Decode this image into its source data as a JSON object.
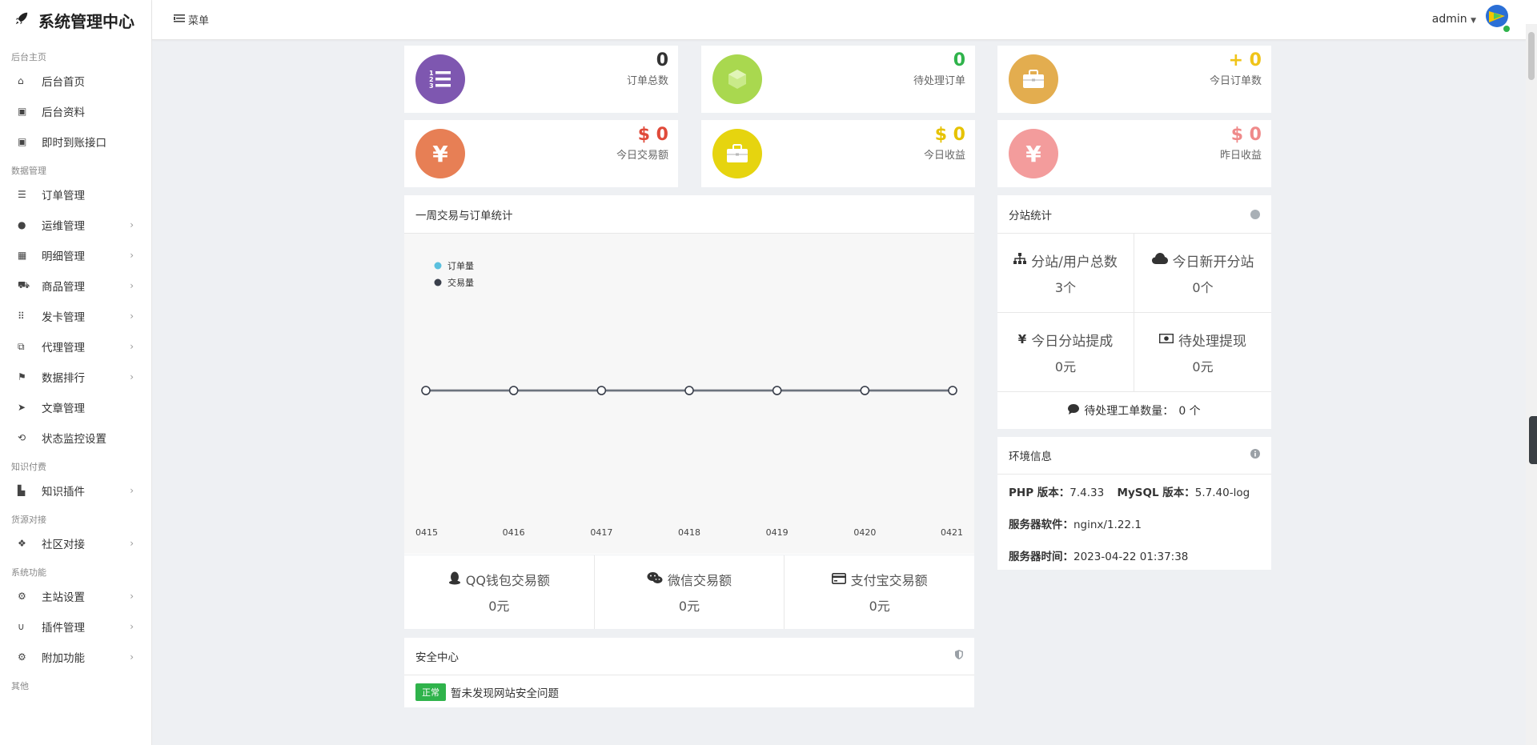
{
  "brand": {
    "title": "系统管理中心",
    "icon": "rocket-icon"
  },
  "topbar": {
    "menu_label": "菜单",
    "user": "admin"
  },
  "sidebar": {
    "sections": [
      {
        "title": "后台主页",
        "items": [
          {
            "label": "后台首页",
            "icon": "home-icon",
            "chevron": false
          },
          {
            "label": "后台资料",
            "icon": "id-card-icon",
            "chevron": false
          },
          {
            "label": "即时到账接口",
            "icon": "id-card-icon",
            "chevron": false
          }
        ]
      },
      {
        "title": "数据管理",
        "items": [
          {
            "label": "订单管理",
            "icon": "list-icon",
            "chevron": false
          },
          {
            "label": "运维管理",
            "icon": "comments-icon",
            "chevron": true
          },
          {
            "label": "明细管理",
            "icon": "calendar-icon",
            "chevron": true
          },
          {
            "label": "商品管理",
            "icon": "cart-icon",
            "chevron": true
          },
          {
            "label": "发卡管理",
            "icon": "grid-icon",
            "chevron": true
          },
          {
            "label": "代理管理",
            "icon": "sitemap-icon",
            "chevron": true
          },
          {
            "label": "数据排行",
            "icon": "flag-icon",
            "chevron": true
          },
          {
            "label": "文章管理",
            "icon": "paper-plane-icon",
            "chevron": false
          },
          {
            "label": "状态监控设置",
            "icon": "refresh-icon",
            "chevron": false
          }
        ]
      },
      {
        "title": "知识付费",
        "items": [
          {
            "label": "知识插件",
            "icon": "chart-icon",
            "chevron": true
          }
        ]
      },
      {
        "title": "货源对接",
        "items": [
          {
            "label": "社区对接",
            "icon": "cubes-icon",
            "chevron": true
          }
        ]
      },
      {
        "title": "系统功能",
        "items": [
          {
            "label": "主站设置",
            "icon": "gear-icon",
            "chevron": true
          },
          {
            "label": "插件管理",
            "icon": "magnet-icon",
            "chevron": true
          },
          {
            "label": "附加功能",
            "icon": "gears-icon",
            "chevron": true
          }
        ]
      },
      {
        "title": "其他",
        "items": []
      }
    ]
  },
  "stats": [
    {
      "value": "0",
      "caption": "订单总数",
      "color": "#7e57b0",
      "value_color": "#333333",
      "icon": "ordered-list-icon"
    },
    {
      "value": "0",
      "caption": "待处理订单",
      "color": "#a9d84f",
      "value_color": "#2fb34b",
      "icon": "cube-icon"
    },
    {
      "value": "+ 0",
      "caption": "今日订单数",
      "color": "#e3ad4f",
      "value_color": "#f0c419",
      "icon": "briefcase-icon"
    },
    {
      "value": "$ 0",
      "caption": "今日交易额",
      "color": "#e77f55",
      "value_color": "#e04a3a",
      "icon": "yen-icon"
    },
    {
      "value": "$ 0",
      "caption": "今日收益",
      "color": "#e6d40f",
      "value_color": "#e6c200",
      "icon": "briefcase-icon"
    },
    {
      "value": "$ 0",
      "caption": "昨日收益",
      "color": "#f39c9c",
      "value_color": "#ef8a8a",
      "icon": "yen-icon"
    }
  ],
  "weekly": {
    "title": "一周交易与订单统计",
    "chart_data": {
      "type": "line",
      "categories": [
        "0415",
        "0416",
        "0417",
        "0418",
        "0419",
        "0420",
        "0421"
      ],
      "series": [
        {
          "name": "订单量",
          "values": [
            0,
            0,
            0,
            0,
            0,
            0,
            0
          ],
          "color": "#5bc0de"
        },
        {
          "name": "交易量",
          "values": [
            0,
            0,
            0,
            0,
            0,
            0,
            0
          ],
          "color": "#3a3f4b"
        }
      ],
      "legend": "top-left"
    }
  },
  "payments": [
    {
      "label": "QQ钱包交易额",
      "value": "0元",
      "icon": "qq-icon"
    },
    {
      "label": "微信交易额",
      "value": "0元",
      "icon": "wechat-icon"
    },
    {
      "label": "支付宝交易额",
      "value": "0元",
      "icon": "credit-card-icon"
    }
  ],
  "security": {
    "title": "安全中心",
    "badge": "正常",
    "message": "暂未发现网站安全问题"
  },
  "substation": {
    "title": "分站统计",
    "cells": [
      {
        "label": "分站/用户总数",
        "value": "3个",
        "icon": "sitemap-icon"
      },
      {
        "label": "今日新开分站",
        "value": "0个",
        "icon": "cloud-icon"
      },
      {
        "label": "今日分站提成",
        "value": "0元",
        "icon": "yen-icon"
      },
      {
        "label": "待处理提现",
        "value": "0元",
        "icon": "money-icon"
      }
    ],
    "ticket_label": "待处理工单数量：",
    "ticket_value": "0 个"
  },
  "env": {
    "title": "环境信息",
    "php_label": "PHP 版本：",
    "php_value": "7.4.33",
    "mysql_label": "MySQL 版本：",
    "mysql_value": "5.7.40-log",
    "server_label": "服务器软件：",
    "server_value": "nginx/1.22.1",
    "time_label": "服务器时间：",
    "time_value": "2023-04-22 01:37:38"
  }
}
